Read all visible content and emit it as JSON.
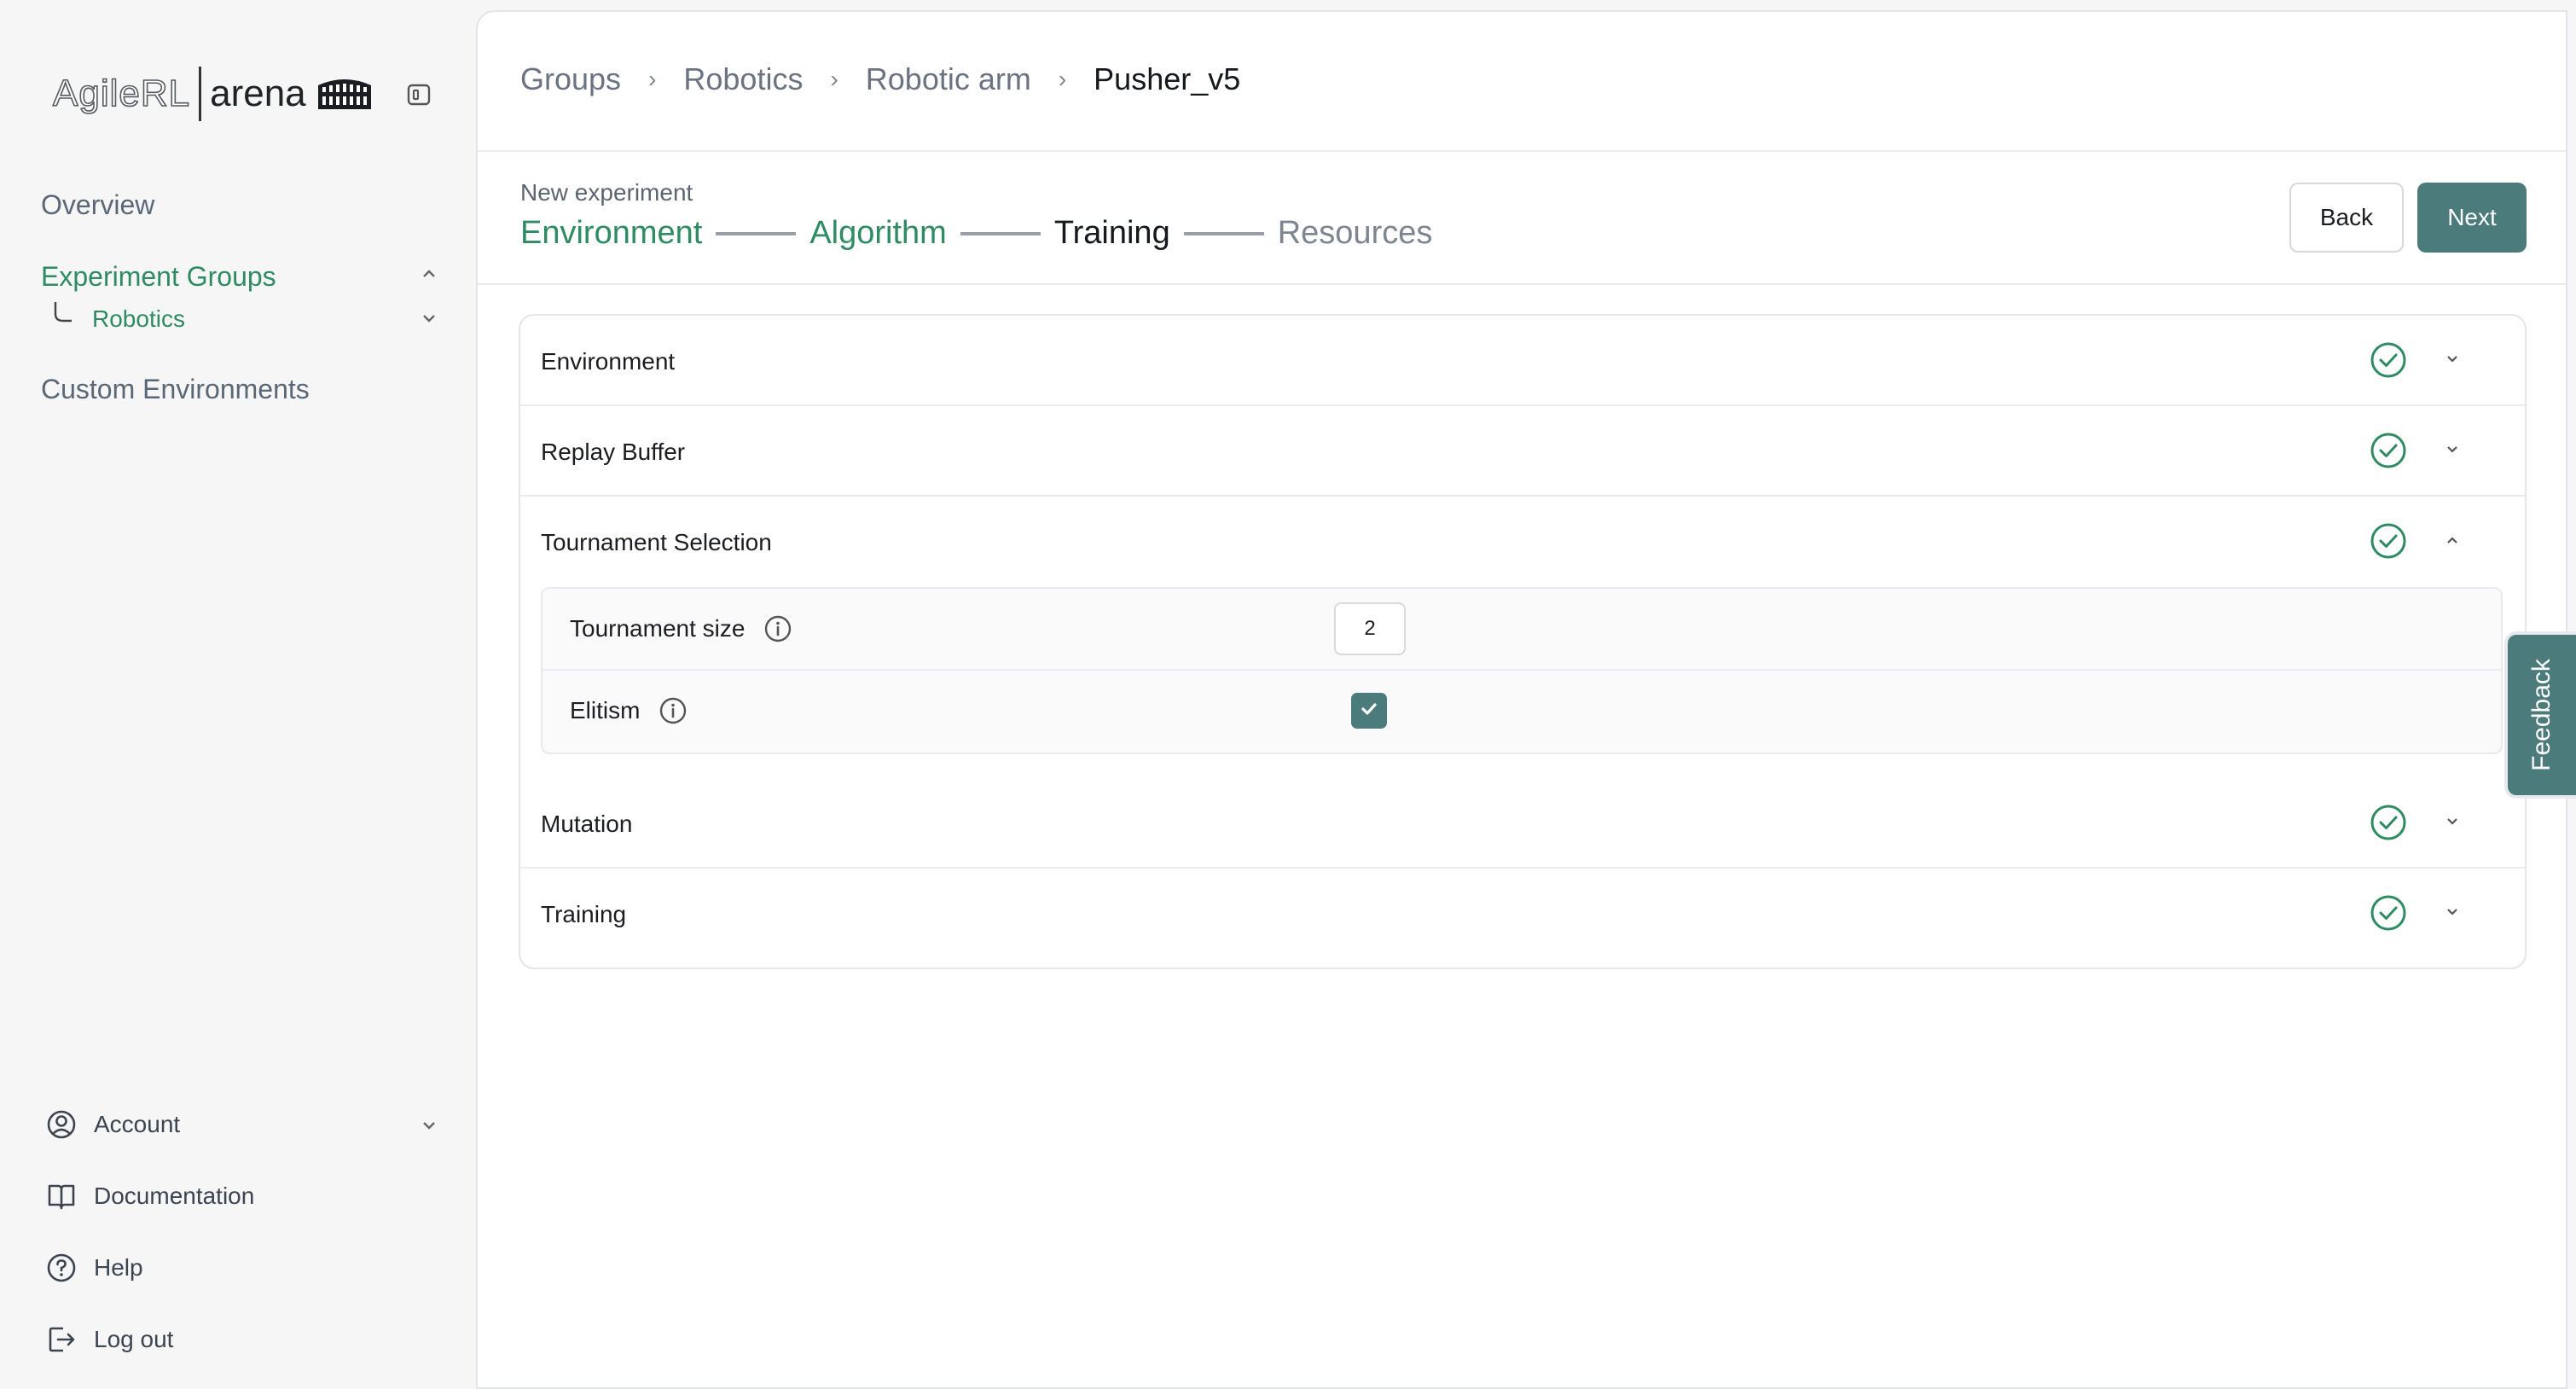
{
  "sidebar": {
    "logo_text": "AgileRL",
    "logo_suffix": "arena",
    "nav": {
      "overview": "Overview",
      "experiment_groups": "Experiment Groups",
      "robotics": "Robotics",
      "custom_environments": "Custom Environments"
    },
    "bottom": {
      "account": "Account",
      "documentation": "Documentation",
      "help": "Help",
      "logout": "Log out"
    }
  },
  "breadcrumb": [
    "Groups",
    "Robotics",
    "Robotic arm",
    "Pusher_v5"
  ],
  "header": {
    "subtitle": "New experiment",
    "steps": [
      {
        "label": "Environment",
        "state": "done"
      },
      {
        "label": "Algorithm",
        "state": "done"
      },
      {
        "label": "Training",
        "state": "current"
      },
      {
        "label": "Resources",
        "state": "future"
      }
    ],
    "back_label": "Back",
    "next_label": "Next"
  },
  "sections": {
    "environment": "Environment",
    "replay_buffer": "Replay Buffer",
    "tournament_selection": "Tournament Selection",
    "mutation": "Mutation",
    "training": "Training"
  },
  "tournament": {
    "size_label": "Tournament size",
    "size_value": "2",
    "elitism_label": "Elitism",
    "elitism_checked": true
  },
  "feedback_label": "Feedback",
  "colors": {
    "accent_green": "#2e8b62",
    "primary_button": "#4c7b7b"
  }
}
